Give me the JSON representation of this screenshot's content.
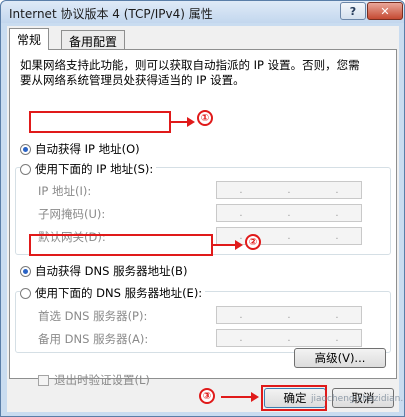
{
  "window": {
    "title": "Internet 协议版本 4 (TCP/IPv4) 属性",
    "help_label": "?",
    "close_label": "✕"
  },
  "tabs": [
    {
      "label": "常规",
      "active": true
    },
    {
      "label": "备用配置",
      "active": false
    }
  ],
  "description": "如果网络支持此功能，则可以获取自动指派的 IP 设置。否则，您需要从网络系统管理员处获得适当的 IP 设置。",
  "ip_section": {
    "auto_label": "自动获得 IP 地址(O)",
    "manual_label": "使用下面的 IP 地址(S):",
    "fields": [
      {
        "label": "IP 地址(I):"
      },
      {
        "label": "子网掩码(U):"
      },
      {
        "label": "默认网关(D):"
      }
    ]
  },
  "dns_section": {
    "auto_label": "自动获得 DNS 服务器地址(B)",
    "manual_label": "使用下面的 DNS 服务器地址(E):",
    "fields": [
      {
        "label": "首选 DNS 服务器(P):"
      },
      {
        "label": "备用 DNS 服务器(A):"
      }
    ]
  },
  "validate_label": "退出时验证设置(L)",
  "buttons": {
    "advanced": "高级(V)...",
    "ok": "确定",
    "cancel": "取消"
  },
  "annotations": [
    "①",
    "②",
    "③"
  ],
  "watermark": "jiaocheng.chazidian.com",
  "colors": {
    "annotation": "#e01a1a",
    "radio_dot": "#2a63c5"
  }
}
